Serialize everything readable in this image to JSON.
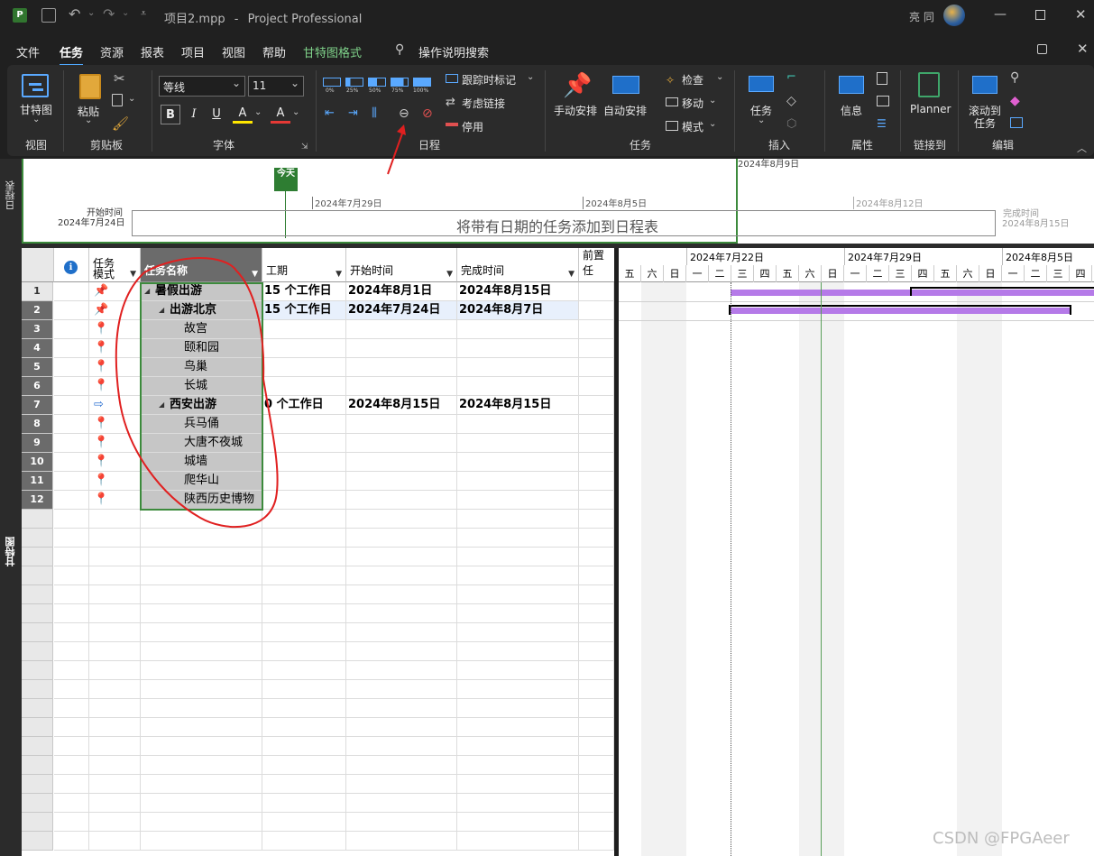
{
  "titlebar": {
    "filename": "项目2.mpp",
    "separator": "-",
    "app": "Project Professional",
    "user": "亮 同"
  },
  "menu": {
    "items": [
      "文件",
      "任务",
      "资源",
      "报表",
      "项目",
      "视图",
      "帮助",
      "甘特图格式"
    ],
    "search": "操作说明搜索"
  },
  "ribbon": {
    "view": {
      "gantt": "甘特图",
      "group": "视图"
    },
    "clipboard": {
      "paste": "粘贴",
      "group": "剪贴板"
    },
    "font": {
      "family": "等线",
      "size": "11",
      "bold": "B",
      "italic": "I",
      "underline": "U",
      "fill": "A",
      "color": "A",
      "group": "字体"
    },
    "schedule": {
      "p0": "0%",
      "p25": "25%",
      "p50": "50%",
      "p75": "75%",
      "p100": "100%",
      "track": "跟踪时标记",
      "respect": "考虑链接",
      "inactivate": "停用",
      "group": "日程"
    },
    "tasks": {
      "manual": "手动安排",
      "auto": "自动安排",
      "inspect": "检查",
      "move": "移动",
      "mode": "模式",
      "group": "任务"
    },
    "insert": {
      "task": "任务",
      "group": "插入"
    },
    "properties": {
      "info": "信息",
      "group": "属性"
    },
    "linkto": {
      "planner": "Planner",
      "group": "链接到"
    },
    "editing": {
      "scroll1": "滚动到",
      "scroll2": "任务",
      "group": "编辑"
    }
  },
  "timeline": {
    "side_label": "日程表",
    "today": "今天",
    "start_label": "开始时间",
    "start_date": "2024年7月24日",
    "finish_label": "完成时间",
    "finish_date": "2024年8月15日",
    "ticks": [
      "2024年7月29日",
      "2024年8月5日",
      "2024年8月12日"
    ],
    "top_date": "2024年8月9日",
    "placeholder": "将带有日期的任务添加到日程表"
  },
  "gantt_side_label": "甘特图",
  "table": {
    "headers": {
      "info": "ℹ",
      "mode1": "任务",
      "mode2": "模式",
      "name": "任务名称",
      "duration": "工期",
      "start": "开始时间",
      "finish": "完成时间",
      "pred": "前置任"
    },
    "rows": [
      {
        "id": "1",
        "name": "暑假出游",
        "duration": "15 个工作日",
        "start": "2024年8月1日",
        "finish": "2024年8月15日"
      },
      {
        "id": "2",
        "name": "出游北京",
        "duration": "15 个工作日",
        "start": "2024年7月24日",
        "finish": "2024年8月7日"
      },
      {
        "id": "3",
        "name": "故宫",
        "duration": "",
        "start": "",
        "finish": ""
      },
      {
        "id": "4",
        "name": "颐和园",
        "duration": "",
        "start": "",
        "finish": ""
      },
      {
        "id": "5",
        "name": "鸟巢",
        "duration": "",
        "start": "",
        "finish": ""
      },
      {
        "id": "6",
        "name": "长城",
        "duration": "",
        "start": "",
        "finish": ""
      },
      {
        "id": "7",
        "name": "西安出游",
        "duration": "0 个工作日",
        "start": "2024年8月15日",
        "finish": "2024年8月15日"
      },
      {
        "id": "8",
        "name": "兵马俑",
        "duration": "",
        "start": "",
        "finish": ""
      },
      {
        "id": "9",
        "name": "大唐不夜城",
        "duration": "",
        "start": "",
        "finish": ""
      },
      {
        "id": "10",
        "name": "城墙",
        "duration": "",
        "start": "",
        "finish": ""
      },
      {
        "id": "11",
        "name": "爬华山",
        "duration": "",
        "start": "",
        "finish": ""
      },
      {
        "id": "12",
        "name": "陕西历史博物",
        "duration": "",
        "start": "",
        "finish": ""
      }
    ]
  },
  "chart": {
    "weeks": [
      "2024年7月22日",
      "2024年7月29日",
      "2024年8月5日"
    ],
    "days": [
      "五",
      "六",
      "日",
      "一",
      "二",
      "三",
      "四",
      "五",
      "六",
      "日",
      "一",
      "二",
      "三",
      "四",
      "五",
      "六",
      "日",
      "一",
      "二",
      "三",
      "四"
    ]
  },
  "watermark": "CSDN @FPGAeer",
  "colors": {
    "bar": "#b57ae8",
    "accent": "#4ea8ff",
    "today": "#2e7d32",
    "annotation": "#e02020"
  }
}
